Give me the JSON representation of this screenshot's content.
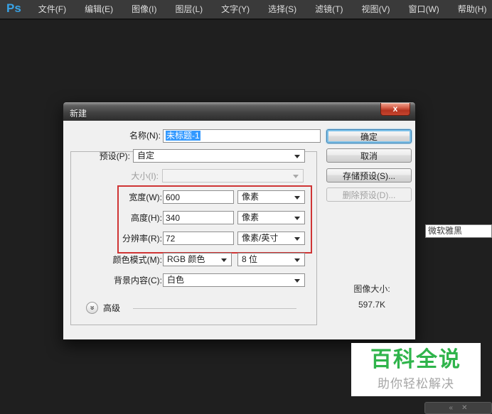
{
  "menubar": {
    "logo": "Ps",
    "items": [
      "文件(F)",
      "编辑(E)",
      "图像(I)",
      "图层(L)",
      "文字(Y)",
      "选择(S)",
      "滤镜(T)",
      "视图(V)",
      "窗口(W)",
      "帮助(H)"
    ]
  },
  "dialog": {
    "title": "新建",
    "close_glyph": "x",
    "name_row": {
      "label": "名称(N):",
      "value": "未标题-1"
    },
    "preset_row": {
      "label": "预设(P):",
      "value": "自定"
    },
    "size_row": {
      "label": "大小(I):",
      "value": ""
    },
    "width_row": {
      "label": "宽度(W):",
      "value": "600",
      "unit": "像素"
    },
    "height_row": {
      "label": "高度(H):",
      "value": "340",
      "unit": "像素"
    },
    "resolution_row": {
      "label": "分辨率(R):",
      "value": "72",
      "unit": "像素/英寸"
    },
    "color_mode_row": {
      "label": "颜色模式(M):",
      "value": "RGB 颜色",
      "depth": "8 位"
    },
    "background_row": {
      "label": "背景内容(C):",
      "value": "白色"
    },
    "advanced": {
      "label": "高级",
      "icon_glyph": "»"
    },
    "buttons": {
      "ok": "确定",
      "cancel": "取消",
      "save_preset": "存储预设(S)...",
      "delete_preset": "删除预设(D)..."
    },
    "image_size": {
      "label": "图像大小:",
      "value": "597.7K"
    }
  },
  "overlays": {
    "font_tooltip": "微软雅黑",
    "watermark": {
      "title": "百科全说",
      "subtitle": "助你轻松解决"
    },
    "mini_bar": {
      "glyph_left": "«",
      "glyph_right": "✕"
    }
  },
  "colors": {
    "selection_blue": "#3399ff",
    "highlight_red": "#cf3434",
    "watermark_green": "#2fb44b",
    "ps_logo_blue": "#38a3e6"
  }
}
